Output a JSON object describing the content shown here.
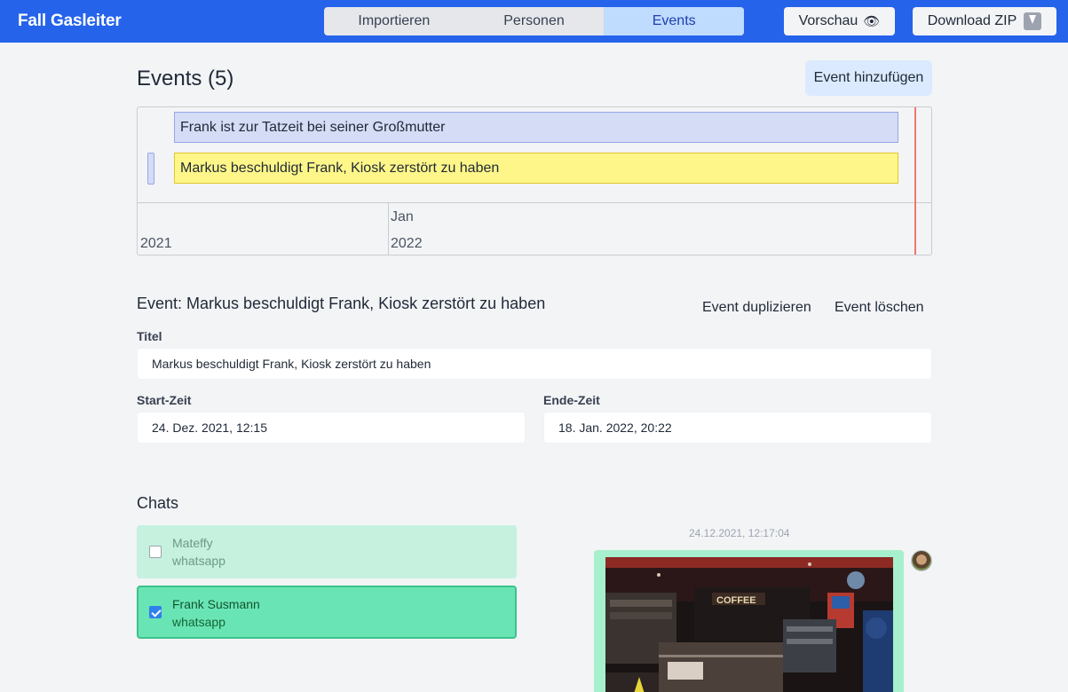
{
  "app": {
    "title": "Fall Gasleiter"
  },
  "nav": {
    "tabs": [
      {
        "label": "Importieren",
        "active": false
      },
      {
        "label": "Personen",
        "active": false
      },
      {
        "label": "Events",
        "active": true
      }
    ],
    "preview_label": "Vorschau",
    "preview_icon": "eye-icon",
    "download_label": "Download ZIP",
    "download_icon": "down-arrow-icon"
  },
  "events": {
    "title": "Events (5)",
    "add_label": "Event hinzufügen"
  },
  "timeline": {
    "items": [
      {
        "label": "Frank ist zur Tatzeit bei seiner Großmutter",
        "color": "#d4dcf6"
      },
      {
        "label": "Markus beschuldigt Frank, Kiosk zerstört zu haben",
        "color": "#fff689"
      }
    ],
    "axis": {
      "minor_label": "Jan",
      "major_labels": [
        "2021",
        "2022"
      ]
    }
  },
  "event_detail": {
    "heading": "Event: Markus beschuldigt Frank, Kiosk zerstört zu haben",
    "duplicate_label": "Event duplizieren",
    "delete_label": "Event löschen",
    "title_label": "Titel",
    "title_value": "Markus beschuldigt Frank, Kiosk zerstört zu haben",
    "start_label": "Start-Zeit",
    "start_value": "24. Dez. 2021, 12:15",
    "end_label": "Ende-Zeit",
    "end_value": "18. Jan. 2022, 20:22"
  },
  "chats": {
    "title": "Chats",
    "items": [
      {
        "name": "Mateffy",
        "source": "whatsapp",
        "checked": false
      },
      {
        "name": "Frank Susmann",
        "source": "whatsapp",
        "checked": true
      }
    ]
  },
  "message": {
    "timestamp": "24.12.2021, 12:17:04",
    "image_text": "COFFEE"
  },
  "colors": {
    "topbar": "#2563eb",
    "active_tab": "#bfdbfe",
    "now_marker": "#f0776a",
    "chat_selected": "#69e5b5"
  }
}
